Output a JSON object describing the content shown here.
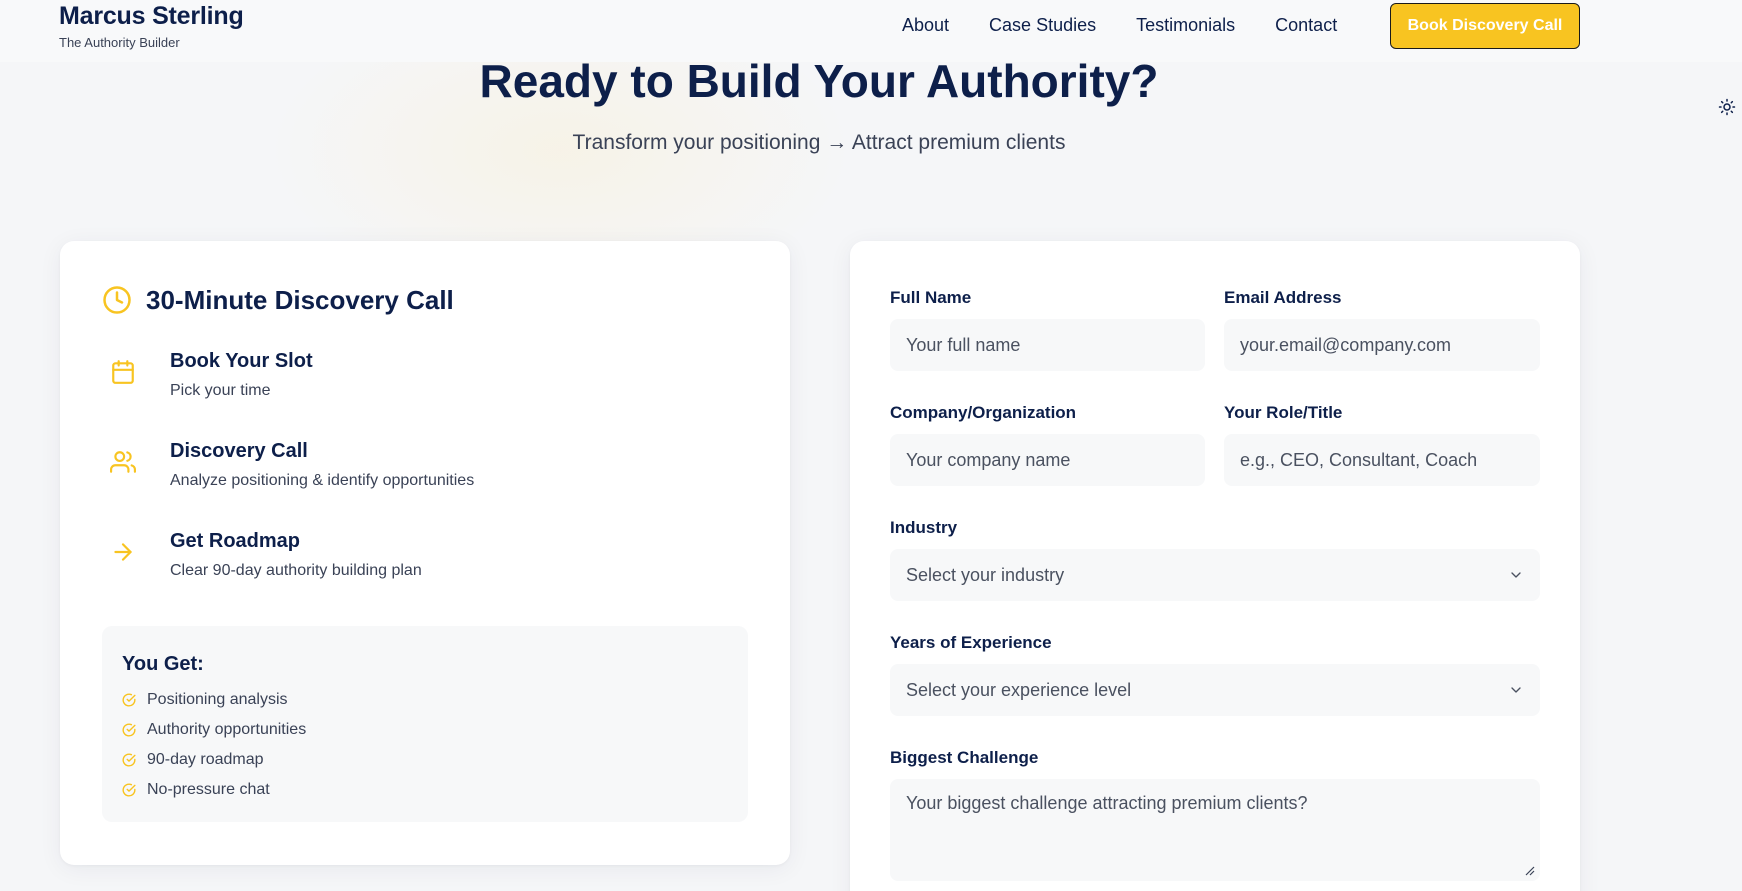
{
  "header": {
    "brand_name": "Marcus Sterling",
    "brand_tagline": "The Authority Builder",
    "nav": [
      "About",
      "Case Studies",
      "Testimonials",
      "Contact"
    ],
    "cta_label": "Book Discovery Call"
  },
  "hero": {
    "title": "Ready to Build Your Authority?",
    "subtitle": "Transform your positioning → Attract premium clients"
  },
  "call_card": {
    "title": "30-Minute Discovery Call",
    "steps": [
      {
        "title": "Book Your Slot",
        "desc": "Pick your time",
        "icon": "calendar-icon"
      },
      {
        "title": "Discovery Call",
        "desc": "Analyze positioning & identify opportunities",
        "icon": "users-icon"
      },
      {
        "title": "Get Roadmap",
        "desc": "Clear 90-day authority building plan",
        "icon": "arrow-right-icon"
      }
    ],
    "benefits_title": "You Get:",
    "benefits": [
      "Positioning analysis",
      "Authority opportunities",
      "90-day roadmap",
      "No-pressure chat"
    ]
  },
  "form": {
    "full_name": {
      "label": "Full Name",
      "placeholder": "Your full name"
    },
    "email": {
      "label": "Email Address",
      "placeholder": "your.email@company.com"
    },
    "company": {
      "label": "Company/Organization",
      "placeholder": "Your company name"
    },
    "role": {
      "label": "Your Role/Title",
      "placeholder": "e.g., CEO, Consultant, Coach"
    },
    "industry": {
      "label": "Industry",
      "selected": "Select your industry"
    },
    "experience": {
      "label": "Years of Experience",
      "selected": "Select your experience level"
    },
    "challenge": {
      "label": "Biggest Challenge",
      "placeholder": "Your biggest challenge attracting premium clients?"
    }
  },
  "colors": {
    "accent": "#f8c421",
    "navy": "#0d1f4a",
    "muted_text": "#3a4256",
    "field_bg": "#f7f8f9"
  }
}
